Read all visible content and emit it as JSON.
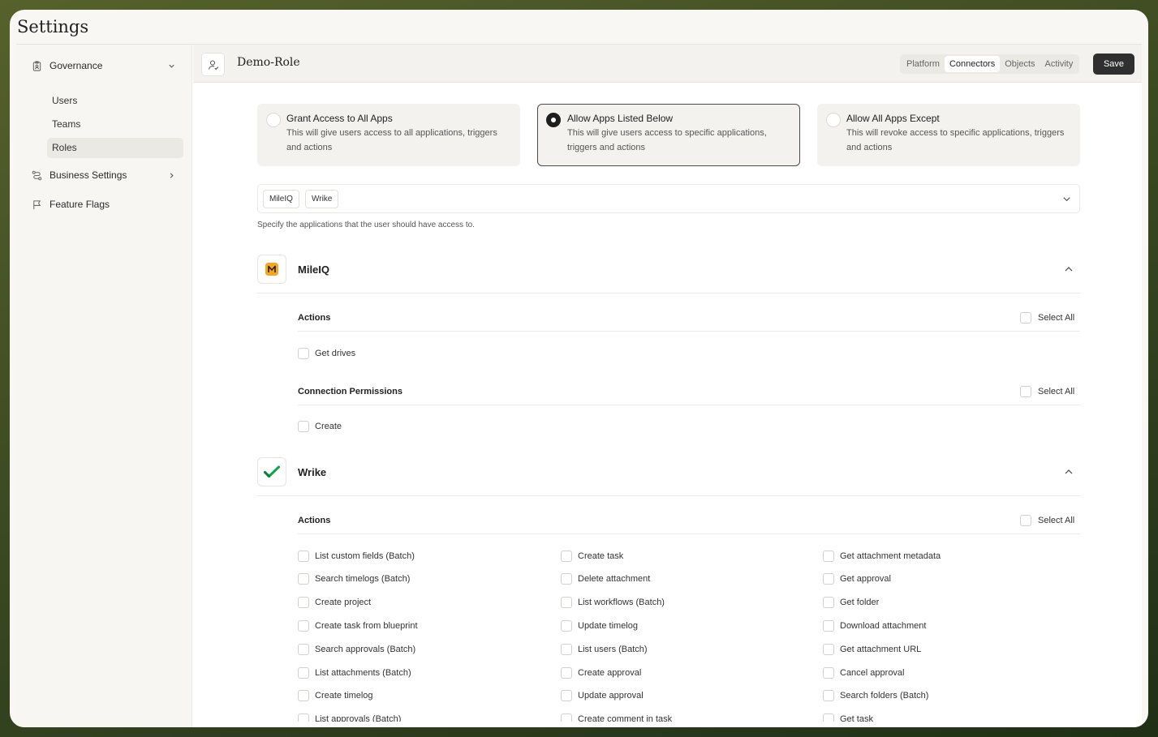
{
  "app": {
    "title": "Settings"
  },
  "sidebar": {
    "governance": {
      "label": "Governance",
      "icon": "clipboard-icon"
    },
    "governance_items": [
      {
        "label": "Users"
      },
      {
        "label": "Teams"
      },
      {
        "label": "Roles",
        "active": true
      }
    ],
    "business": {
      "label": "Business Settings",
      "icon": "route-icon"
    },
    "flags": {
      "label": "Feature Flags",
      "icon": "flag-icon"
    }
  },
  "header": {
    "role_name": "Demo-Role",
    "tabs": [
      {
        "label": "Platform"
      },
      {
        "label": "Connectors",
        "active": true
      },
      {
        "label": "Objects"
      },
      {
        "label": "Activity"
      }
    ],
    "save_label": "Save"
  },
  "access_options": [
    {
      "title": "Grant Access to All Apps",
      "desc": "This will give users access to all applications, triggers and actions",
      "selected": false
    },
    {
      "title": "Allow Apps Listed Below",
      "desc": "This will give users access to specific applications, triggers and actions",
      "selected": true
    },
    {
      "title": "Allow All Apps Except",
      "desc": "This will revoke access to specific applications, triggers and actions",
      "selected": false
    }
  ],
  "app_select": {
    "chips": [
      "MileIQ",
      "Wrike"
    ],
    "helper": "Specify the applications that the user should have access to."
  },
  "apps": {
    "mileiq": {
      "name": "MileIQ",
      "logo_color": "#f5a623",
      "actions_label": "Actions",
      "select_all": "Select All",
      "actions": [
        "Get drives"
      ],
      "connection_label": "Connection Permissions",
      "connection": [
        "Create"
      ]
    },
    "wrike": {
      "name": "Wrike",
      "logo_color": "#08a84a",
      "actions_label": "Actions",
      "select_all": "Select All",
      "actions_col1": [
        "List custom fields (Batch)",
        "Search timelogs (Batch)",
        "Create project",
        "Create task from blueprint",
        "Search approvals (Batch)",
        "List attachments (Batch)",
        "Create timelog",
        "List approvals (Batch)"
      ],
      "actions_col2": [
        "Create task",
        "Delete attachment",
        "List workflows (Batch)",
        "Update timelog",
        "List users (Batch)",
        "Create approval",
        "Update approval",
        "Create comment in task"
      ],
      "actions_col3": [
        "Get attachment metadata",
        "Get approval",
        "Get folder",
        "Download attachment",
        "Get attachment URL",
        "Cancel approval",
        "Search folders (Batch)",
        "Get task"
      ]
    }
  }
}
